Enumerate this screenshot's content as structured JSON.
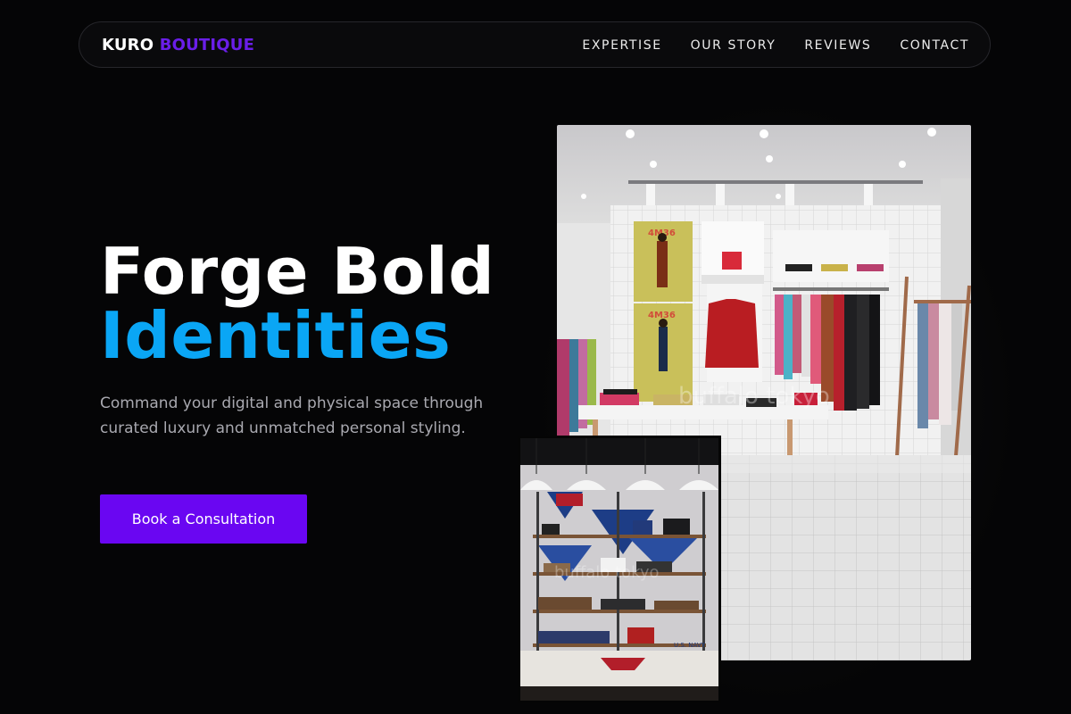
{
  "brand": {
    "word1": "KURO",
    "word2": "BOUTIQUE",
    "word2_color": "#6a1ee8"
  },
  "nav": {
    "links": [
      "EXPERTISE",
      "OUR STORY",
      "REVIEWS",
      "CONTACT"
    ]
  },
  "hero": {
    "title_line1": "Forge Bold",
    "title_line2": "Identities",
    "title_line2_color": "#0aa6f5",
    "subtitle": "Command your digital and physical space through curated luxury and unmatched personal styling.",
    "cta_label": "Book a Consultation",
    "cta_color": "#6a06f2"
  },
  "images": {
    "main": {
      "poster_text_top": "4M36",
      "poster_text_bottom": "4M36",
      "watermark": "buffalo tokyo"
    },
    "secondary": {
      "watermark": "buffalo tokyo",
      "sign_text": "U.S. NAVY"
    }
  }
}
